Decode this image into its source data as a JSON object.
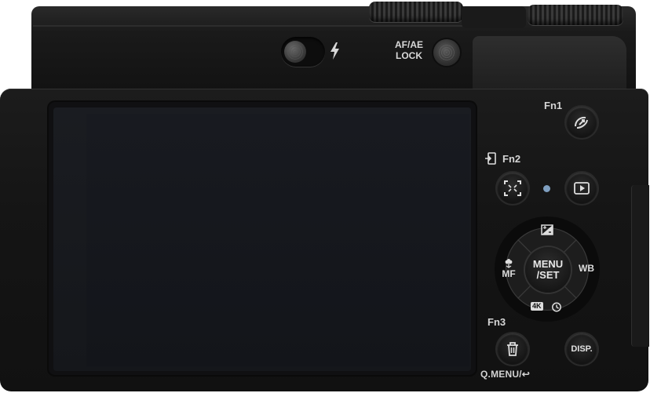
{
  "camera": {
    "top_controls": {
      "flash_icon": "flash-bolt-icon",
      "af_ae_label_line1": "AF/AE",
      "af_ae_label_line2": "LOCK"
    },
    "function_buttons": {
      "fn1_label": "Fn1",
      "fn1_icon": "post-focus-icon",
      "fn2_label": "Fn2",
      "fn2_icon": "focus-frame-icon",
      "fn3_label": "Fn3",
      "fn3_icon": "trash-icon",
      "playback_icon": "playback-icon",
      "disp_label": "DISP.",
      "qmenu_label": "Q.MENU/↩"
    },
    "control_pad": {
      "center_line1": "MENU",
      "center_line2": "/SET",
      "up_icon": "exposure-compensation-icon",
      "left_label": "MF",
      "left_icon": "macro-flower-icon",
      "right_label": "WB",
      "down_icon": "4k-photo-self-timer-icon",
      "down_badge": "4K"
    },
    "colors": {
      "body": "#151515",
      "screen": "#171920",
      "led": "#7f9fc0",
      "text": "#d5d5d5"
    }
  }
}
